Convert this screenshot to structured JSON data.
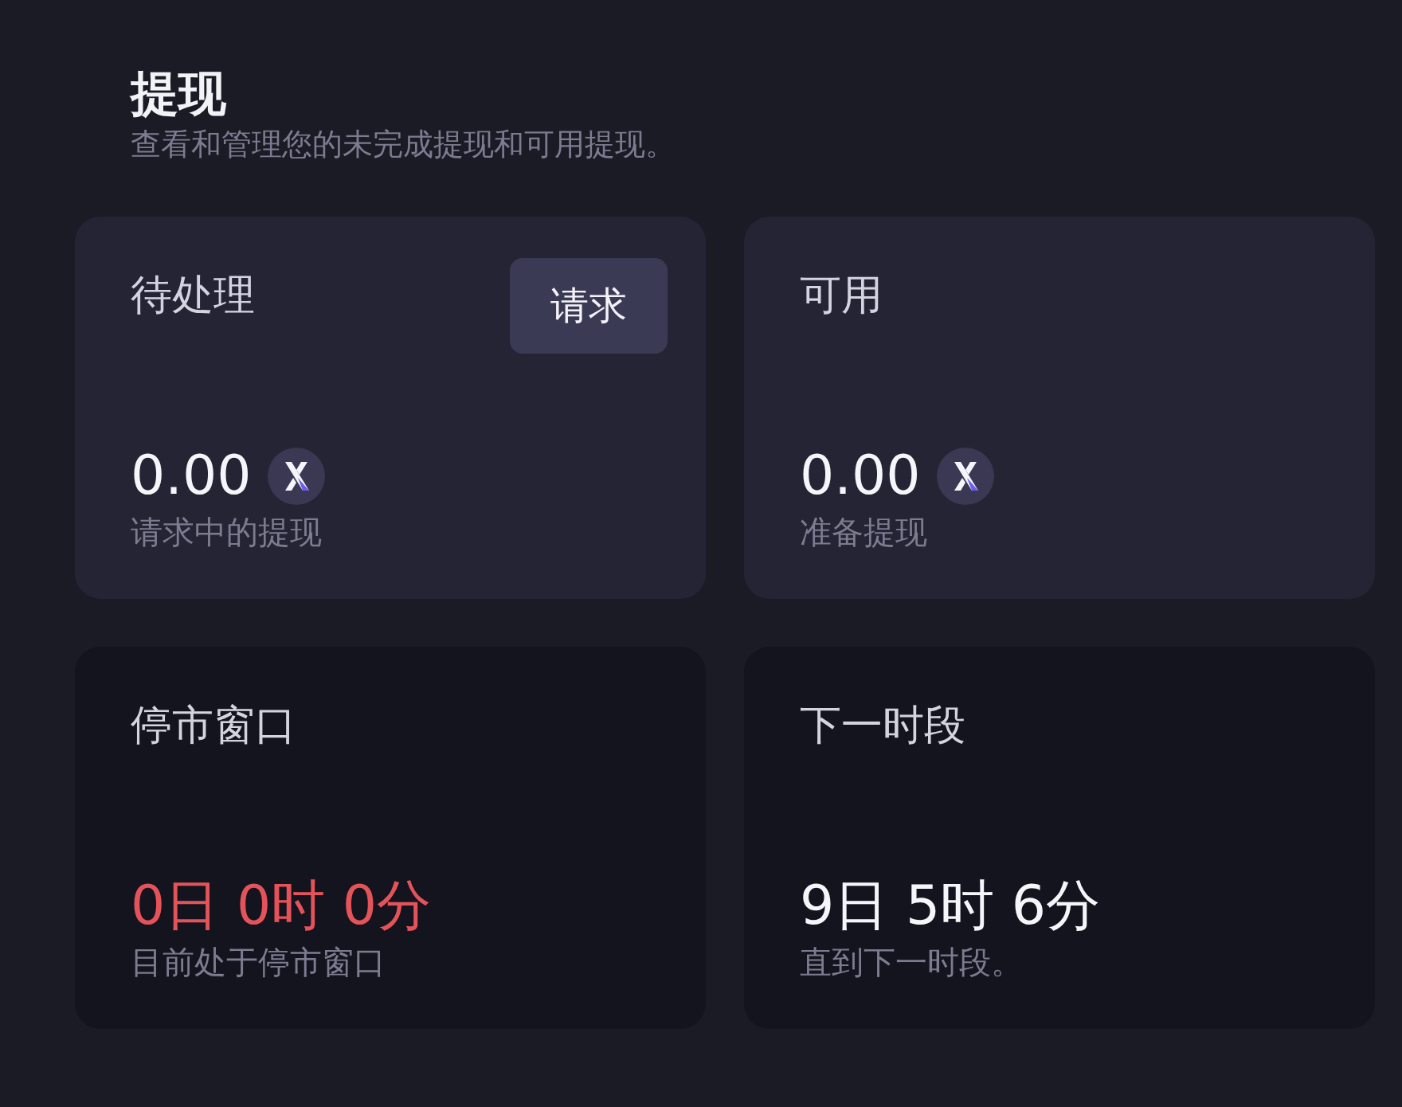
{
  "header": {
    "title": "提现",
    "subtitle": "查看和管理您的未完成提现和可用提现。"
  },
  "cards": [
    {
      "kind": "balance",
      "title": "待处理",
      "button": "请求",
      "value": "0.00",
      "caption": "请求中的提现"
    },
    {
      "kind": "balance",
      "title": "可用",
      "value": "0.00",
      "caption": "准备提现"
    },
    {
      "kind": "countdown",
      "alert": true,
      "title": "停市窗口",
      "value": "0日 0时 0分",
      "caption": "目前处于停市窗口"
    },
    {
      "kind": "countdown",
      "alert": false,
      "title": "下一时段",
      "value": "9日 5时 6分",
      "caption": "直到下一时段。"
    }
  ]
}
